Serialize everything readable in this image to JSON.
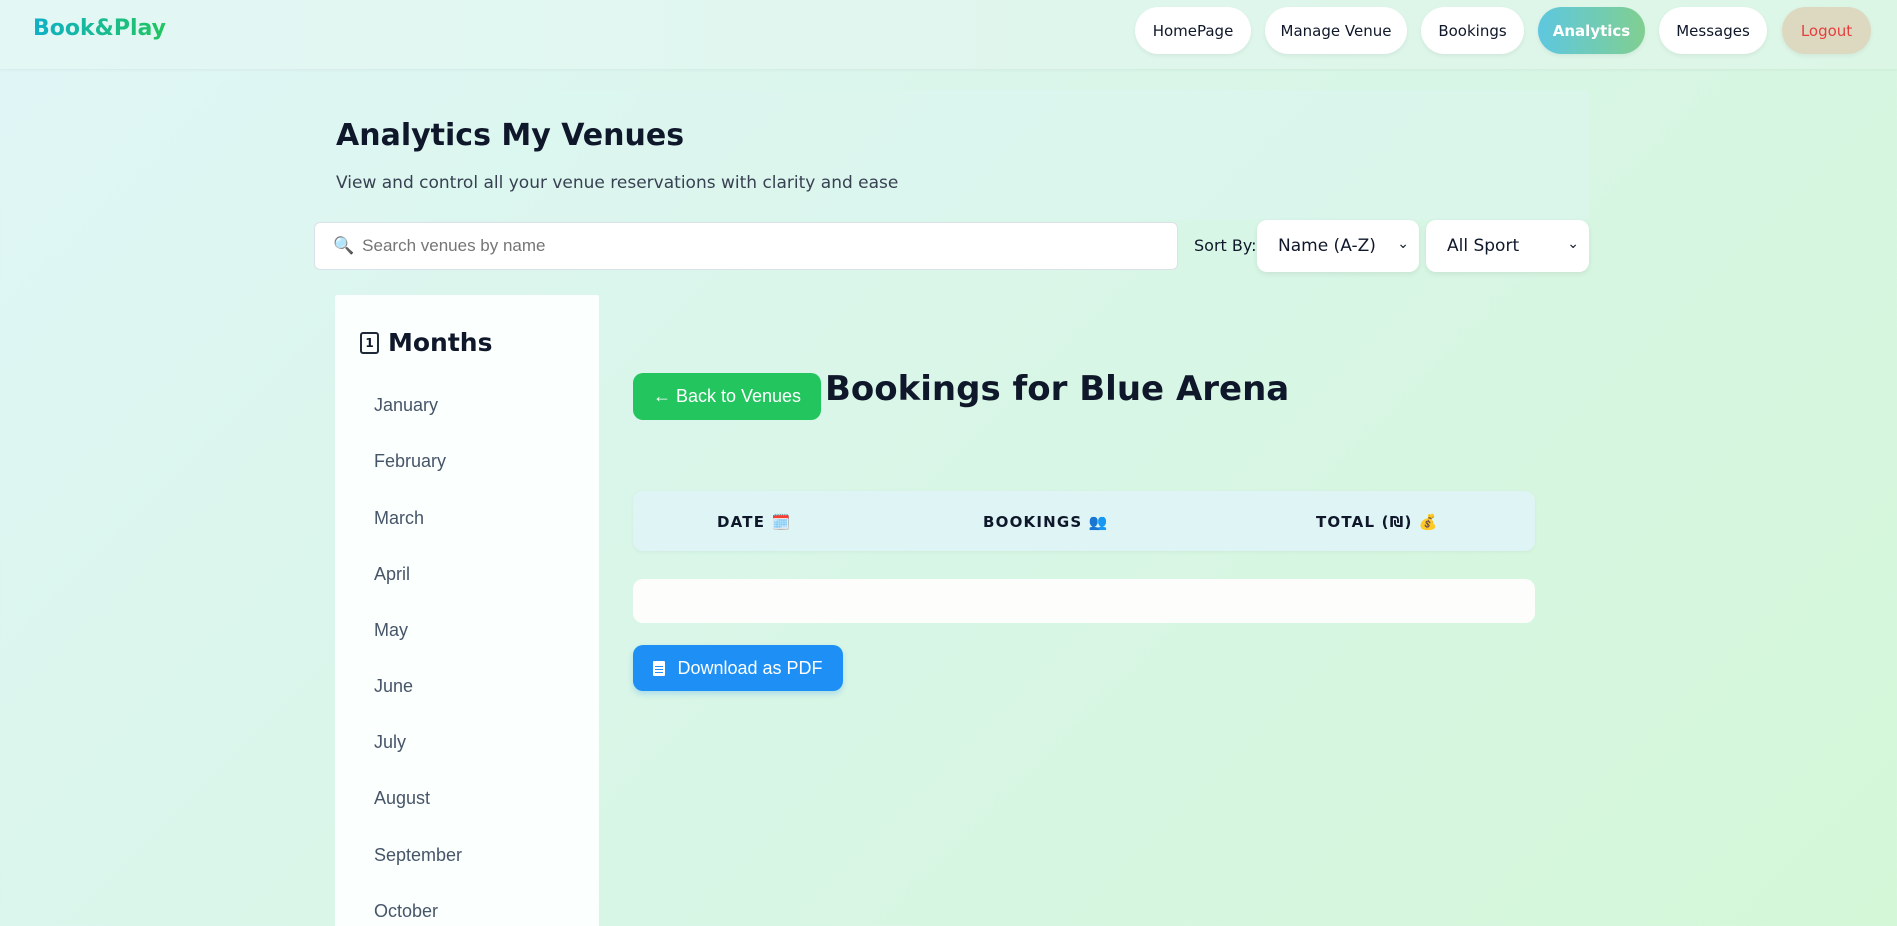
{
  "nav": {
    "logo": "Book&Play",
    "items": [
      {
        "label": "HomePage"
      },
      {
        "label": "Manage Venue"
      },
      {
        "label": "Bookings"
      },
      {
        "label": "Analytics"
      },
      {
        "label": "Messages"
      },
      {
        "label": "Logout"
      }
    ],
    "active": "Analytics"
  },
  "header": {
    "title": "Analytics My Venues",
    "subtitle": "View and control all your venue reservations with clarity and ease"
  },
  "search": {
    "icon": "search-icon",
    "placeholder": "Search venues by name",
    "value": ""
  },
  "sort": {
    "label": "Sort By:",
    "selected": "Name (A-Z)"
  },
  "sport_filter": {
    "selected": "All Sport"
  },
  "sidebar": {
    "heading": "Months",
    "icon": "calendar-icon",
    "months": [
      "January",
      "February",
      "March",
      "April",
      "May",
      "June",
      "July",
      "August",
      "September",
      "October"
    ]
  },
  "main": {
    "back_label": "← Back to Venues",
    "title": "Bookings for Blue Arena",
    "columns": [
      "DATE 🗓️",
      "BOOKINGS 👥",
      "TOTAL (₪) 💰"
    ],
    "rows": [],
    "download_label": "Download as PDF"
  },
  "colors": {
    "accent_green": "#22c55e",
    "accent_blue": "#1e90f5",
    "logout_red": "#e53e3e"
  }
}
